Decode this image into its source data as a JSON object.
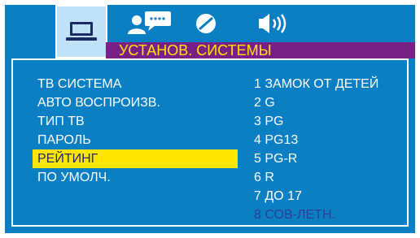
{
  "tabs": [
    {
      "icon": "laptop-icon",
      "active": true
    },
    {
      "icon": "language-icon",
      "active": false
    },
    {
      "icon": "disc-icon",
      "active": false
    },
    {
      "icon": "speaker-icon",
      "active": false
    }
  ],
  "title": "УСТАНОВ. СИСТЕМЫ",
  "settings_menu": [
    {
      "label": "ТВ СИСТЕМА"
    },
    {
      "label": "АВТО ВОСПРОИЗВ."
    },
    {
      "label": "ТИП ТВ"
    },
    {
      "label": "ПАРОЛЬ"
    },
    {
      "label": "РЕЙТИНГ",
      "selected": true
    },
    {
      "label": "ПО УМОЛЧ."
    }
  ],
  "rating_options": [
    {
      "label": "1 ЗАМОК ОТ ДЕТЕЙ"
    },
    {
      "label": "2 G"
    },
    {
      "label": "3 PG"
    },
    {
      "label": "4 PG13"
    },
    {
      "label": "5 PG-R"
    },
    {
      "label": "6 R"
    },
    {
      "label": "7 ДО 17"
    },
    {
      "label": "8 СОВ-ЛЕТН.",
      "current": true
    }
  ],
  "colors": {
    "background": "#0a7fc3",
    "title_bar": "#7a1f86",
    "highlight": "#ffe600",
    "current_option": "#2f3a97"
  }
}
